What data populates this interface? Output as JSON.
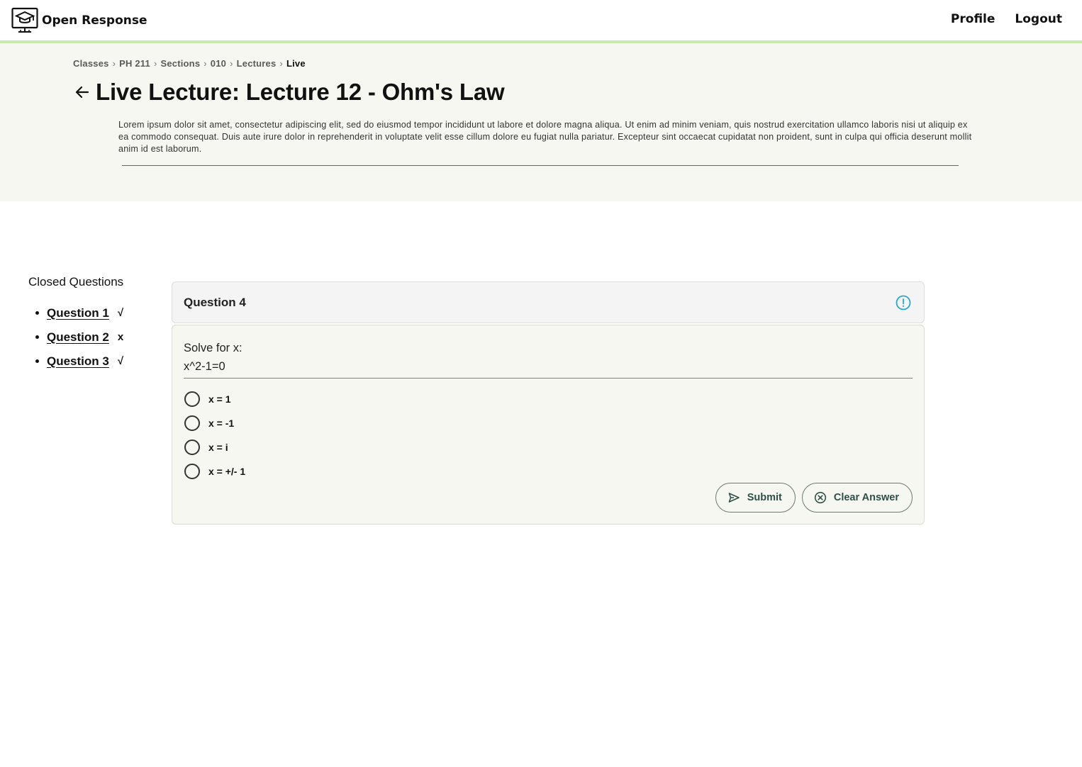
{
  "app": {
    "name": "Open Response",
    "logo_icon": "graduation-monitor-icon"
  },
  "nav": {
    "profile": "Profile",
    "logout": "Logout"
  },
  "breadcrumb": {
    "items": [
      "Classes",
      "PH 211",
      "Sections",
      "010",
      "Lectures"
    ],
    "current": "Live",
    "separator": "›"
  },
  "page": {
    "title": "Live Lecture: Lecture 12 - Ohm's Law",
    "description": "Lorem ipsum dolor sit amet, consectetur adipiscing elit, sed do eiusmod tempor incididunt ut labore et dolore magna aliqua. Ut enim ad minim veniam, quis nostrud exercitation ullamco laboris nisi ut aliquip ex ea commodo consequat. Duis aute irure dolor in reprehenderit in voluptate velit esse cillum dolore eu fugiat nulla pariatur. Excepteur sint occaecat cupidatat non proident, sunt in culpa qui officia deserunt mollit anim id est laborum."
  },
  "sidebar": {
    "title": "Closed Questions",
    "questions": [
      {
        "label": "Question 1",
        "mark": "√"
      },
      {
        "label": "Question 2",
        "mark": "x"
      },
      {
        "label": "Question 3",
        "mark": "√"
      }
    ]
  },
  "question": {
    "title": "Question 4",
    "prompt_line1": "Solve for x:",
    "prompt_line2": "x^2-1=0",
    "options": [
      "x = 1",
      "x = -1",
      "x = i",
      "x = +/- 1"
    ],
    "submit_label": "Submit",
    "clear_label": "Clear Answer"
  },
  "colors": {
    "accent_bar": "#c8eab0",
    "header_bg": "#f6f7f0",
    "info_icon": "#2aa7c9",
    "button_text": "#2f4f4a"
  }
}
